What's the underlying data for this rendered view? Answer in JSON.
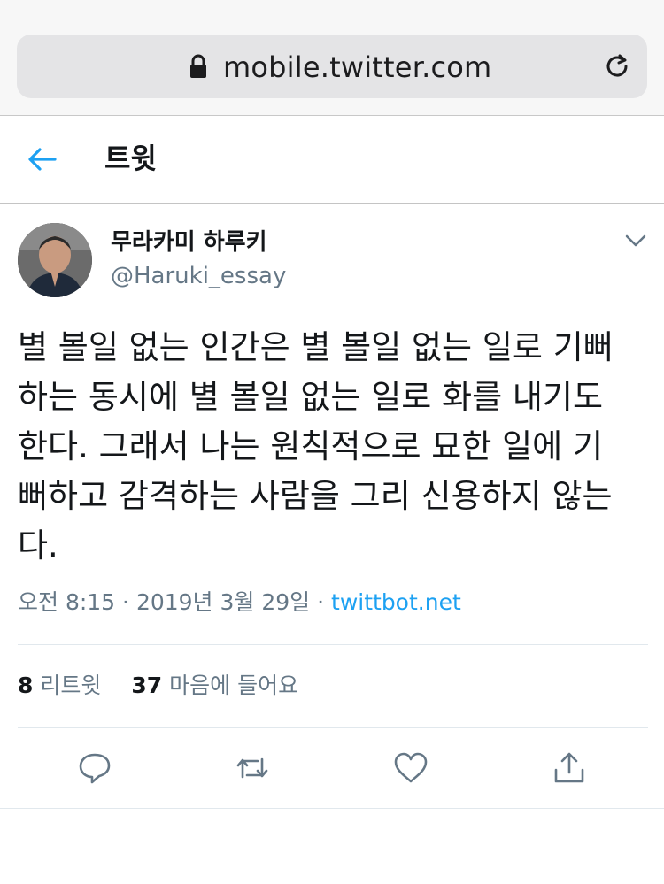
{
  "browser": {
    "url": "mobile.twitter.com"
  },
  "header": {
    "title": "트윗"
  },
  "tweet": {
    "display_name": "무라카미 하루키",
    "handle": "@Haruki_essay",
    "text": "별 볼일 없는 인간은 별 볼일 없는 일로 기뻐\n하는 동시에 별 볼일 없는 일로 화를 내기도\n한다. 그래서 나는 원칙적으로 묘한 일에 기\n뻐하고 감격하는 사람을 그리 신용하지 않는\n다.",
    "time": "오전 8:15",
    "separator": " · ",
    "date": "2019년 3월 29일",
    "source": "twittbot.net"
  },
  "stats": {
    "retweet_count": "8",
    "retweet_label": "리트윗",
    "like_count": "37",
    "like_label": "마음에 들어요"
  },
  "icons": {
    "lock": "lock-icon",
    "reload": "reload-icon",
    "back": "back-arrow-icon",
    "chevron": "chevron-down-icon",
    "reply": "reply-icon",
    "retweet": "retweet-icon",
    "like": "heart-icon",
    "share": "share-icon"
  },
  "colors": {
    "accent": "#1da1f2",
    "muted_text": "#657786",
    "primary_text": "#14171a"
  }
}
